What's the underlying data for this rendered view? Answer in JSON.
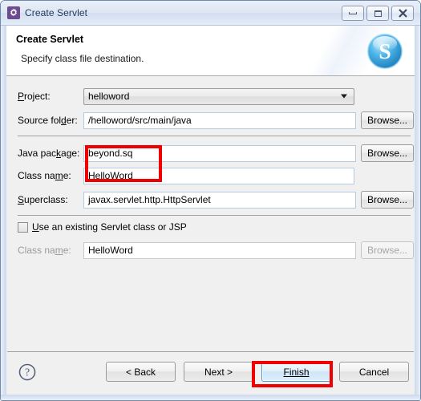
{
  "window": {
    "title": "Create Servlet",
    "icon": "gear-icon",
    "accent_color": "#6e4b8e",
    "controls": {
      "minimize": "Minimize",
      "maximize": "Maximize",
      "close": "Close"
    }
  },
  "header": {
    "title": "Create Servlet",
    "subtitle": "Specify class file destination.",
    "logo": "servlet-s-logo"
  },
  "form": {
    "project": {
      "label": "Project:",
      "mnemonic": "P",
      "value": "helloword",
      "control": "combo"
    },
    "source_folder": {
      "label": "Source folder:",
      "value": "/helloword/src/main/java",
      "browse_label": "Browse..."
    },
    "java_package": {
      "label": "Java package:",
      "value": "beyond.sq",
      "browse_label": "Browse..."
    },
    "class_name": {
      "label": "Class name:",
      "value": "HelloWord"
    },
    "superclass": {
      "label": "Superclass:",
      "value": "javax.servlet.http.HttpServlet",
      "browse_label": "Browse..."
    },
    "use_existing": {
      "label": "Use an existing Servlet class or JSP",
      "checked": false
    },
    "existing_class_name": {
      "label": "Class name:",
      "value": "HelloWord",
      "browse_label": "Browse...",
      "disabled": true
    }
  },
  "footer": {
    "help": "?",
    "back": "< Back",
    "next": "Next >",
    "finish": "Finish",
    "cancel": "Cancel",
    "focused_button": "Finish"
  },
  "annotations": {
    "highlight_color": "#f00000",
    "boxes": [
      {
        "target": "java-package-and-class-name-values"
      },
      {
        "target": "finish-button"
      }
    ]
  }
}
